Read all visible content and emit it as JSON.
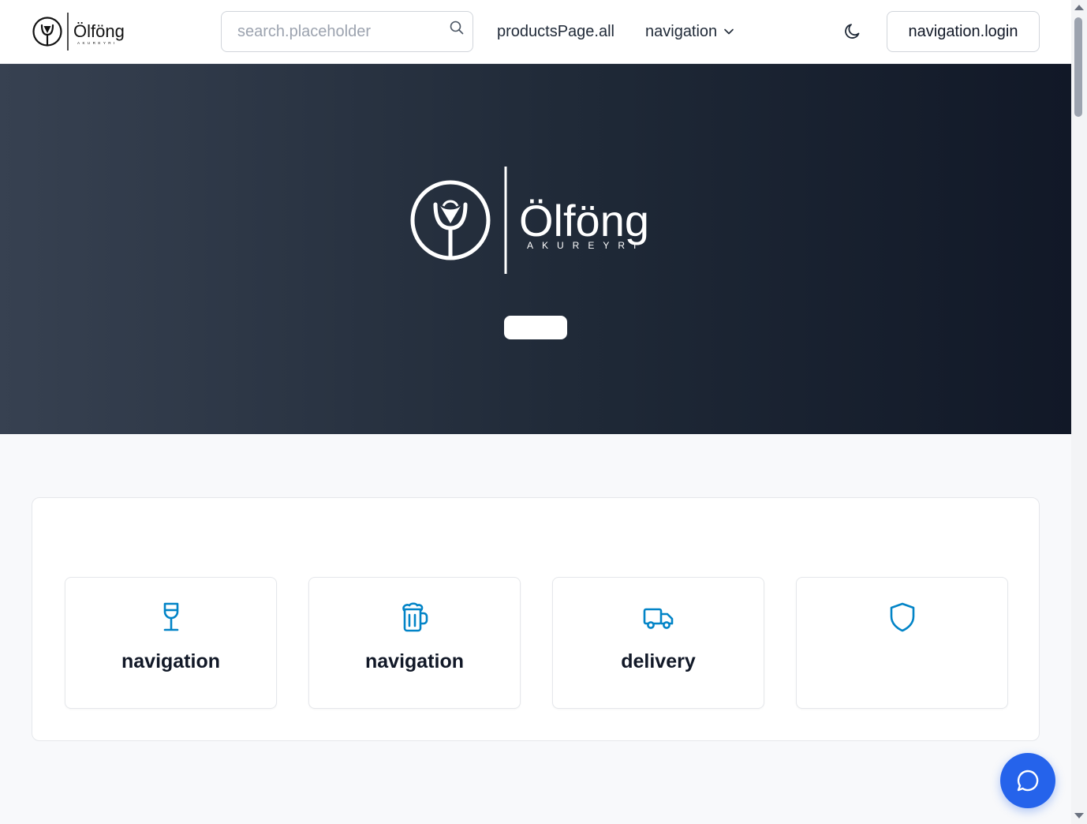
{
  "header": {
    "logo_name": "Ölföng",
    "logo_sub": "AKUREYRI",
    "search": {
      "placeholder": "search.placeholder",
      "value": ""
    },
    "nav": {
      "all_products_label": "productsPage.all",
      "dropdown_label": "navigation"
    },
    "login_label": "navigation.login"
  },
  "hero": {
    "logo_name": "Ölföng",
    "logo_sub": "AKUREYRI",
    "cta_label": ""
  },
  "features": [
    {
      "icon": "wine-glass-icon",
      "title": "navigation"
    },
    {
      "icon": "beer-mug-icon",
      "title": "navigation"
    },
    {
      "icon": "truck-icon",
      "title": "delivery"
    },
    {
      "icon": "shield-icon",
      "title": ""
    }
  ],
  "colors": {
    "accent_icon": "#0284c7",
    "chat_button": "#2563eb",
    "hero_gradient_start": "#374151",
    "hero_gradient_end": "#111827"
  },
  "chat": {
    "icon": "chat-bubble-icon"
  }
}
